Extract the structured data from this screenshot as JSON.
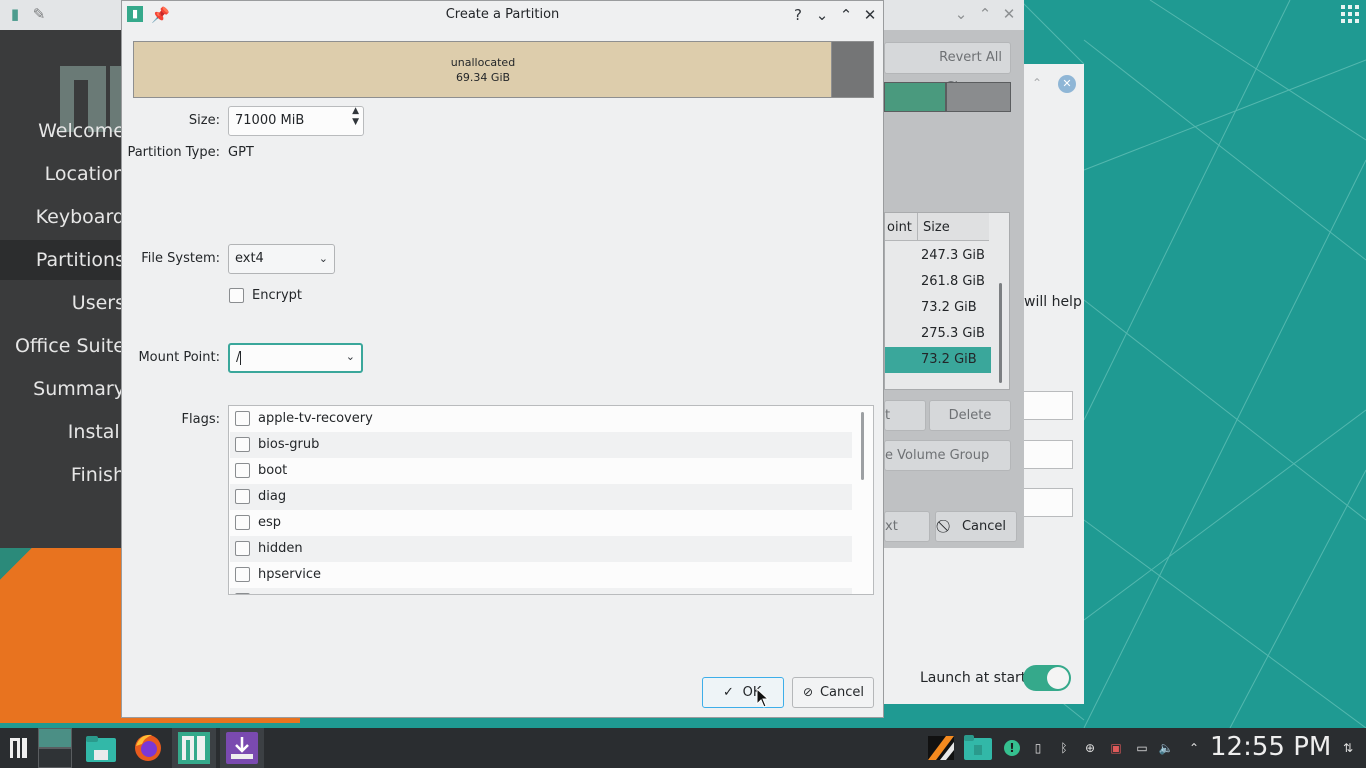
{
  "dialog": {
    "title": "Create a Partition",
    "bar": {
      "label": "unallocated",
      "size": "69.34 GiB"
    },
    "size_label": "Size:",
    "size_value": "71000 MiB",
    "ptype_label": "Partition Type:",
    "ptype_value": "GPT",
    "fs_label": "File System:",
    "fs_value": "ext4",
    "encrypt_label": "Encrypt",
    "mount_label": "Mount Point:",
    "mount_value": "/",
    "flags_label": "Flags:",
    "flags": [
      "apple-tv-recovery",
      "bios-grub",
      "boot",
      "diag",
      "esp",
      "hidden",
      "hpservice"
    ],
    "ok_label": "OK",
    "cancel_label": "Cancel"
  },
  "installer": {
    "sidebar": [
      "Welcome",
      "Location",
      "Keyboard",
      "Partitions",
      "Users",
      "Office Suite",
      "Summary",
      "Install",
      "Finish"
    ],
    "revert_label": "Revert All Changes",
    "table_header": [
      "oint",
      "Size"
    ],
    "table_rows": [
      "247.3 GiB",
      "261.8 GiB",
      "73.2 GiB",
      "275.3 GiB",
      "73.2 GiB"
    ],
    "delete_label": "Delete",
    "edit_label": "t",
    "volume_group_label": "e Volume Group",
    "next_label": "xt",
    "cancel_label": "Cancel"
  },
  "welcome": {
    "help_text": "will help",
    "launch_label": "Launch at start"
  },
  "taskbar": {
    "clock": "12:55 PM"
  },
  "colors": {
    "accent": "#3daee9",
    "selection": "#3aa79b",
    "desktop": "#1f9a92",
    "toggle": "#35a98b",
    "orange": "#e8731f"
  }
}
